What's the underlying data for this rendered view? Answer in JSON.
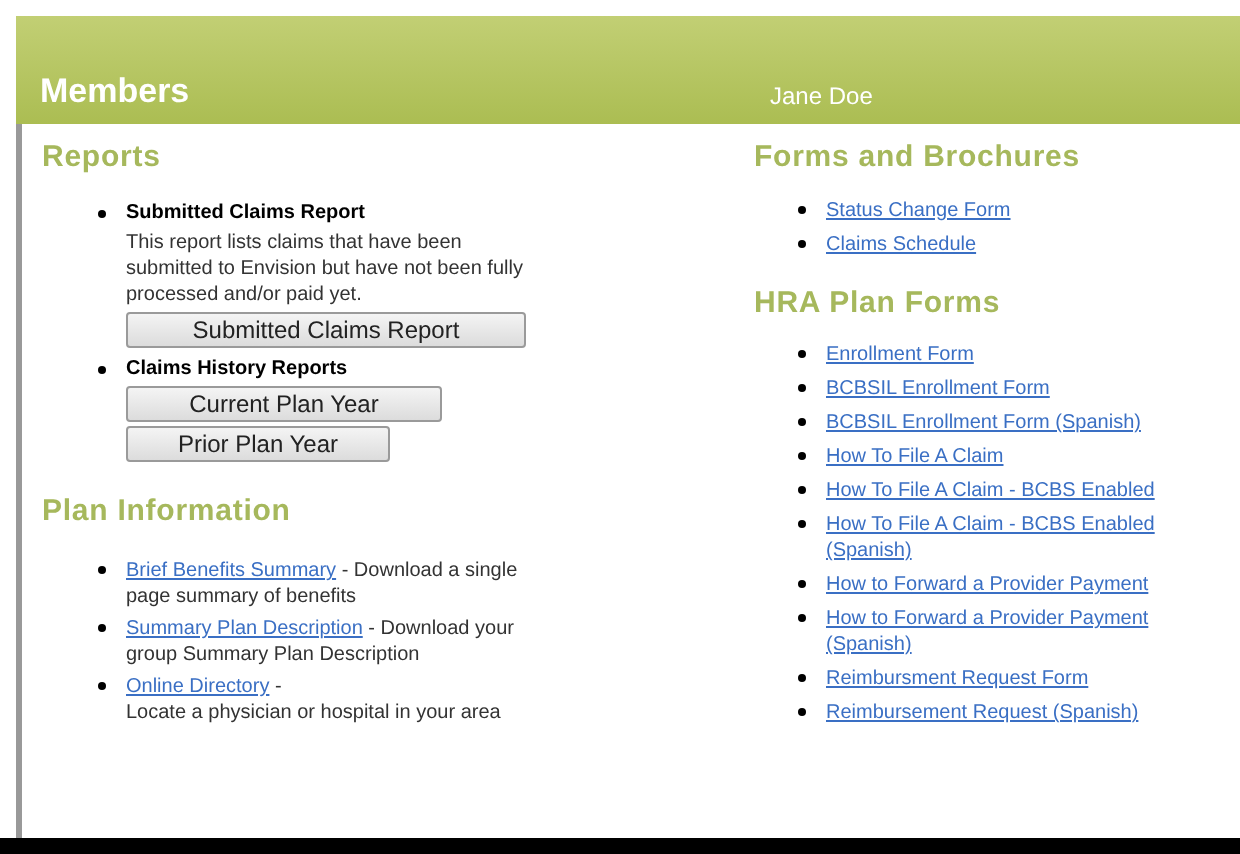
{
  "header": {
    "title": "Members",
    "user": "Jane Doe"
  },
  "reports": {
    "heading": "Reports",
    "items": [
      {
        "title": "Submitted Claims Report",
        "description": "This report lists claims that have been submitted to Envision but have not been fully processed and/or paid yet.",
        "buttons": [
          "Submitted Claims Report"
        ]
      },
      {
        "title": "Claims History Reports",
        "buttons": [
          "Current Plan Year",
          "Prior Plan Year"
        ]
      }
    ]
  },
  "plan_information": {
    "heading": "Plan Information",
    "items": [
      {
        "link": "Brief Benefits Summary",
        "description": " - Download a single page summary of benefits"
      },
      {
        "link": "Summary Plan Description",
        "description": " - Download your group Summary Plan Description"
      },
      {
        "link": "Online Directory",
        "description": " -",
        "detail": "Locate a physician or hospital in your area"
      }
    ]
  },
  "forms_and_brochures": {
    "heading": "Forms and Brochures",
    "links": [
      "Status Change Form",
      "Claims Schedule"
    ]
  },
  "hra_plan_forms": {
    "heading": "HRA Plan Forms",
    "links": [
      "Enrollment Form",
      "BCBSIL Enrollment Form",
      "BCBSIL Enrollment Form (Spanish)",
      "How To File A Claim",
      "How To File A Claim - BCBS Enabled",
      "How To File A Claim - BCBS Enabled (Spanish)",
      "How to Forward a Provider Payment",
      "How to Forward a Provider Payment (Spanish)",
      "Reimbursment Request Form",
      "Reimbursement Request (Spanish)"
    ]
  }
}
